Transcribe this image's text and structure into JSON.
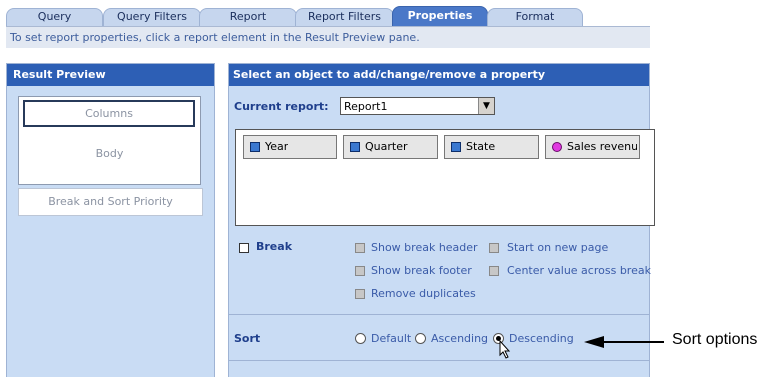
{
  "tabs": [
    {
      "label": "Query",
      "active": false
    },
    {
      "label": "Query Filters",
      "active": false
    },
    {
      "label": "Report",
      "active": false
    },
    {
      "label": "Report Filters",
      "active": false
    },
    {
      "label": "Properties",
      "active": true
    },
    {
      "label": "Format",
      "active": false
    }
  ],
  "info_text": "To set report properties, click a report element in the Result Preview pane.",
  "result_preview": {
    "title": "Result Preview",
    "columns_label": "Columns",
    "body_label": "Body",
    "break_sort_label": "Break and Sort Priority"
  },
  "properties_panel": {
    "title": "Select an object to add/change/remove a property",
    "current_report_label": "Current report:",
    "current_report_value": "Report1",
    "objects": [
      {
        "label": "Year",
        "icon": "dimension-icon"
      },
      {
        "label": "Quarter",
        "icon": "dimension-icon"
      },
      {
        "label": "State",
        "icon": "dimension-icon"
      },
      {
        "label": "Sales revenu",
        "icon": "measure-icon"
      }
    ],
    "break": {
      "label": "Break",
      "checked": false,
      "options": [
        "Show break header",
        "Start on new page",
        "Show break footer",
        "Center value across break",
        "Remove duplicates"
      ]
    },
    "sort": {
      "label": "Sort",
      "options": [
        "Default",
        "Ascending",
        "Descending"
      ],
      "selected": "Descending"
    }
  },
  "annotation": {
    "text": "Sort options"
  },
  "colors": {
    "header": "#2d5fb5",
    "panel": "#c9dcf4",
    "active_tab": "#4a78c8"
  }
}
